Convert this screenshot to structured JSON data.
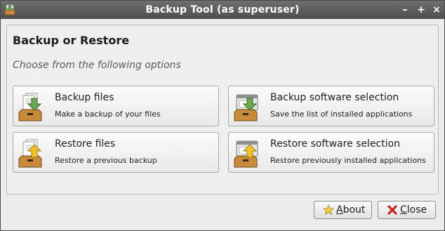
{
  "window": {
    "title": "Backup Tool (as superuser)",
    "controls": {
      "minimize": "–",
      "maximize": "+",
      "close": "×"
    }
  },
  "header": {
    "title": "Backup or Restore",
    "subtitle": "Choose from the following options"
  },
  "options": [
    {
      "title": "Backup files",
      "description": "Make a backup of your files",
      "icon": "backup-files-icon"
    },
    {
      "title": "Backup software selection",
      "description": "Save the list of installed applications",
      "icon": "backup-software-icon"
    },
    {
      "title": "Restore files",
      "description": "Restore a previous backup",
      "icon": "restore-files-icon"
    },
    {
      "title": "Restore software selection",
      "description": "Restore previously installed applications",
      "icon": "restore-software-icon"
    }
  ],
  "buttons": {
    "about": {
      "mnemonic": "A",
      "rest": "bout",
      "icon": "star-icon"
    },
    "close": {
      "mnemonic": "C",
      "rest": "lose",
      "icon": "red-x-icon"
    }
  },
  "colors": {
    "titlebar": "#5a5a5a",
    "arrow_green": "#6aa84f",
    "arrow_yellow": "#f2c12e",
    "box_brown": "#c98a3a",
    "close_red": "#cc2222",
    "star_yellow": "#f5d33b"
  }
}
